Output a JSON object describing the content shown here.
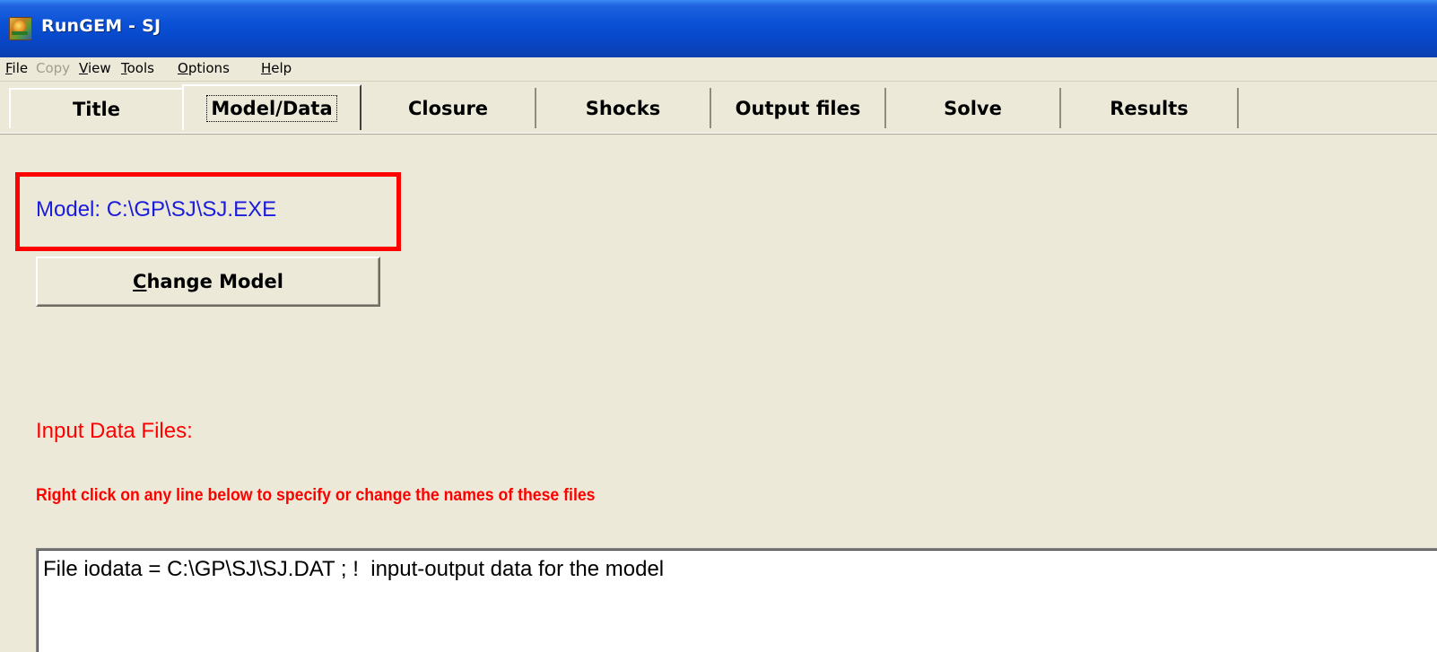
{
  "window": {
    "title": "RunGEM - SJ",
    "icon": "rungem-app-icon"
  },
  "menu": [
    {
      "label": "File",
      "mnemonic": "F",
      "rest": "ile",
      "enabled": true
    },
    {
      "label": "Copy",
      "mnemonic": "",
      "rest": "Copy",
      "enabled": false
    },
    {
      "label": "View",
      "mnemonic": "V",
      "rest": "iew",
      "enabled": true
    },
    {
      "label": "Tools",
      "mnemonic": "T",
      "rest": "ools",
      "enabled": true
    },
    {
      "label": "Options",
      "mnemonic": "O",
      "rest": "ptions",
      "enabled": true
    },
    {
      "label": "Help",
      "mnemonic": "H",
      "rest": "elp",
      "enabled": true
    }
  ],
  "tabs": [
    {
      "label": "Title",
      "active": false
    },
    {
      "label": "Model/Data",
      "active": true
    },
    {
      "label": "Closure",
      "active": false
    },
    {
      "label": "Shocks",
      "active": false
    },
    {
      "label": "Output files",
      "active": false
    },
    {
      "label": "Solve",
      "active": false
    },
    {
      "label": "Results",
      "active": false
    }
  ],
  "model": {
    "label": "Model: C:\\GP\\SJ\\SJ.EXE",
    "change_button": {
      "mnemonic": "C",
      "rest": "hange Model"
    }
  },
  "input_files": {
    "heading": "Input Data Files:",
    "hint": "Right click on any line below to specify or change the names of these files",
    "lines": [
      "File iodata = C:\\GP\\SJ\\SJ.DAT ; !  input-output data for the model"
    ]
  },
  "colors": {
    "model_text": "#1b1bdd",
    "heading_text": "#ff0000",
    "highlight_box": "#ff0000",
    "background": "#ECE9D8"
  }
}
